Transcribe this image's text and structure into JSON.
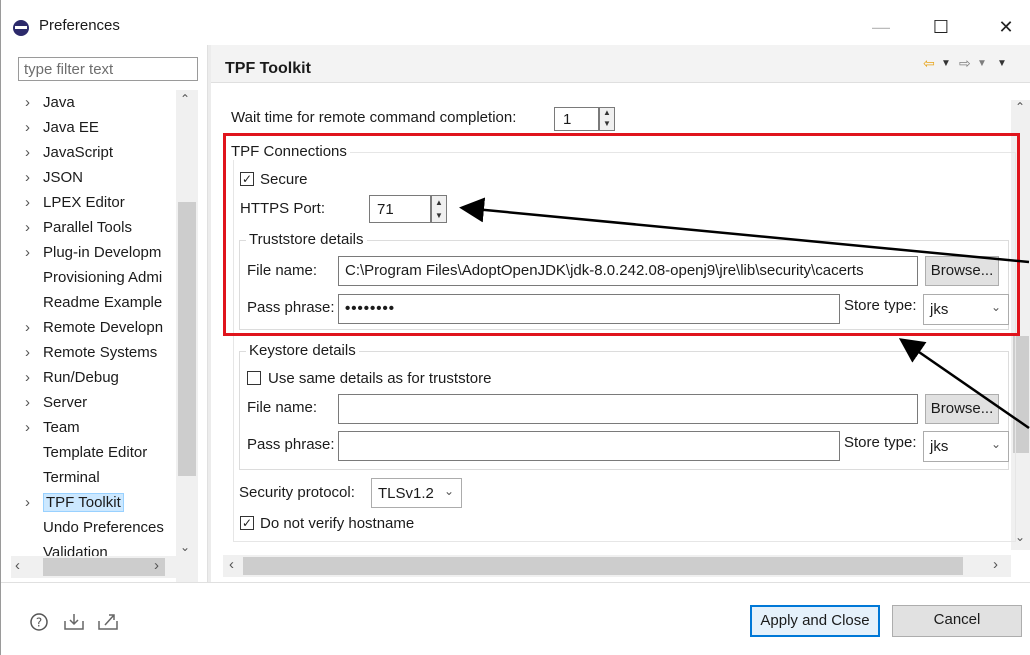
{
  "window": {
    "title": "Preferences",
    "minimize": "—",
    "maximize": "☐",
    "close": "✕"
  },
  "filter": {
    "placeholder": "type filter text"
  },
  "tree": [
    {
      "label": "Java",
      "arrow": "›"
    },
    {
      "label": "Java EE",
      "arrow": "›"
    },
    {
      "label": "JavaScript",
      "arrow": "›"
    },
    {
      "label": "JSON",
      "arrow": "›"
    },
    {
      "label": "LPEX Editor",
      "arrow": "›"
    },
    {
      "label": "Parallel Tools",
      "arrow": "›"
    },
    {
      "label": "Plug-in Developm",
      "arrow": "›"
    },
    {
      "label": "Provisioning Admi",
      "arrow": ""
    },
    {
      "label": "Readme Example",
      "arrow": ""
    },
    {
      "label": "Remote Developn",
      "arrow": "›"
    },
    {
      "label": "Remote Systems",
      "arrow": "›"
    },
    {
      "label": "Run/Debug",
      "arrow": "›"
    },
    {
      "label": "Server",
      "arrow": "›"
    },
    {
      "label": "Team",
      "arrow": "›"
    },
    {
      "label": "Template Editor",
      "arrow": ""
    },
    {
      "label": "Terminal",
      "arrow": ""
    },
    {
      "label": "TPF Toolkit",
      "arrow": "›"
    },
    {
      "label": "Undo Preferences",
      "arrow": ""
    },
    {
      "label": "Validation",
      "arrow": ""
    }
  ],
  "page": {
    "title": "TPF Toolkit",
    "wait_label": "Wait time for remote command completion:",
    "wait_value": "1",
    "connections_title": "TPF Connections",
    "secure_label": "Secure",
    "secure_checked": "✓",
    "port_label": "HTTPS Port:",
    "port_value": "71",
    "truststore_title": "Truststore details",
    "file_name_label": "File name:",
    "truststore_file": "C:\\Program Files\\AdoptOpenJDK\\jdk-8.0.242.08-openj9\\jre\\lib\\security\\cacerts",
    "browse_label": "Browse...",
    "pass_phrase_label": "Pass phrase:",
    "truststore_pass": "••••••••",
    "store_type_label": "Store type:",
    "store_type_value": "jks",
    "keystore_title": "Keystore details",
    "same_details_label": "Use same details as for truststore",
    "keystore_file": "",
    "keystore_pass": "",
    "protocol_label": "Security protocol:",
    "protocol_value": "TLSv1.2",
    "no_verify_label": "Do not verify hostname",
    "no_verify_checked": "✓"
  },
  "footer": {
    "apply_close": "Apply and Close",
    "cancel": "Cancel"
  }
}
